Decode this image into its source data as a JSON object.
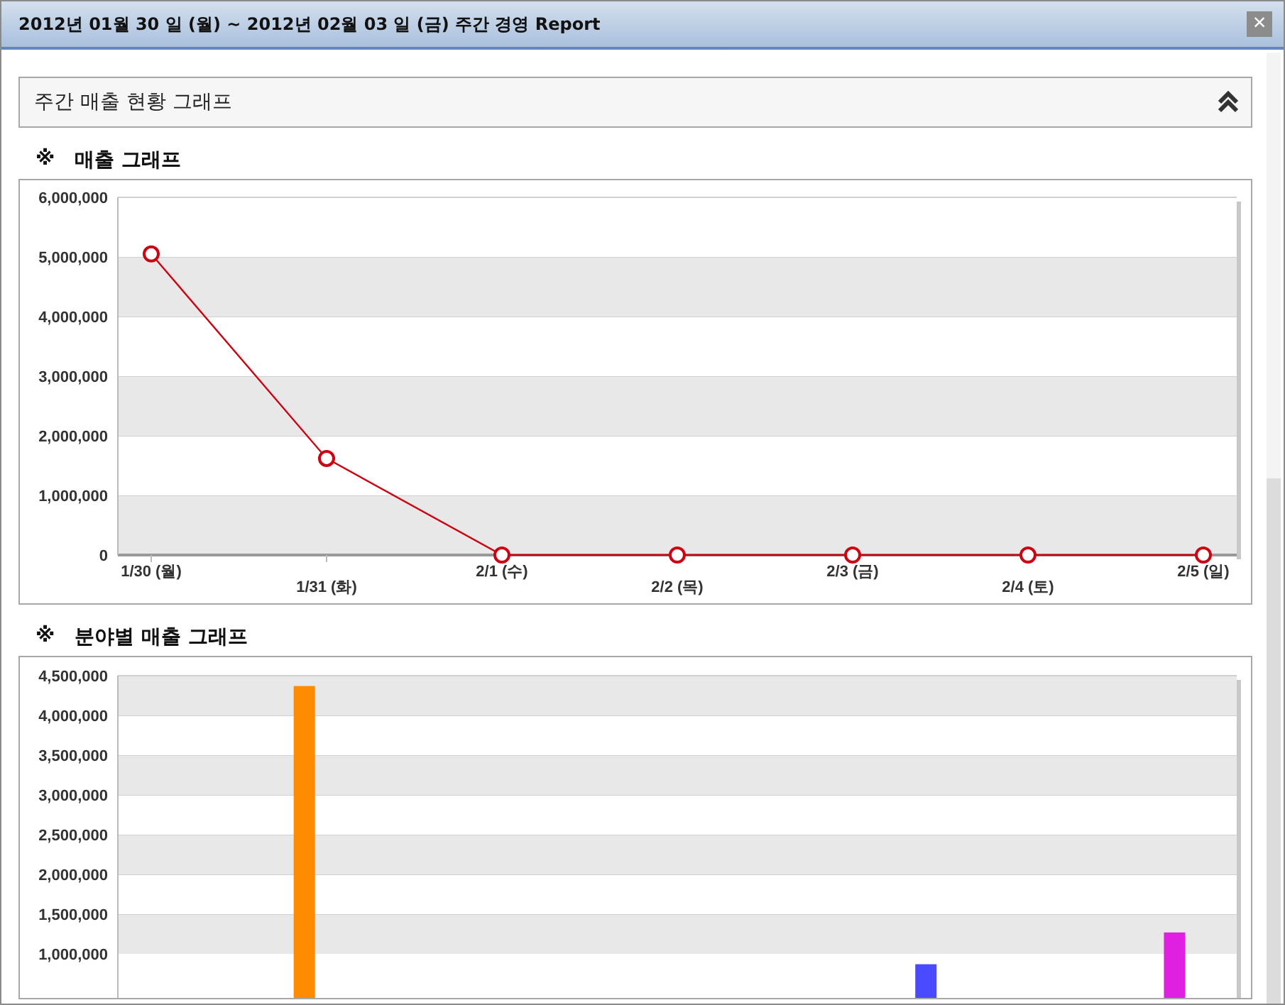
{
  "window": {
    "title": "2012년 01월 30 일 (월) ~ 2012년 02월 03 일 (금) 주간 경영 Report",
    "close": "×"
  },
  "section": {
    "title": "주간 매출 현황 그래프",
    "expanded": true
  },
  "charts": [
    {
      "mark": "※",
      "chart_data": {
        "type": "line",
        "title": "매출 그래프",
        "categories": [
          "1/30 (월)",
          "1/31 (화)",
          "2/1 (수)",
          "2/2 (목)",
          "2/3 (금)",
          "2/4 (토)",
          "2/5 (일)"
        ],
        "grid": true,
        "series": [
          {
            "color": "#cc0010",
            "marker": "o",
            "values": [
              5050000,
              1620000,
              0,
              0,
              0,
              0,
              0
            ]
          }
        ],
        "ylim": [
          0,
          6000000
        ],
        "yticks": [
          {
            "value": 0,
            "label": "0"
          },
          {
            "value": 1000000,
            "label": "1,000,000"
          },
          {
            "value": 2000000,
            "label": "2,000,000"
          },
          {
            "value": 3000000,
            "label": "3,000,000"
          },
          {
            "value": 4000000,
            "label": "4,000,000"
          },
          {
            "value": 5000000,
            "label": "5,000,000"
          },
          {
            "value": 6000000,
            "label": "6,000,000"
          }
        ]
      }
    },
    {
      "mark": "※",
      "chart_data": {
        "type": "bar",
        "title": "분야별 매출 그래프",
        "stacked": true,
        "grid": true,
        "series": [
          {
            "color": "#ff8c00",
            "values": [
              null,
              4370000,
              null,
              null,
              null,
              null,
              null,
              null,
              null
            ]
          },
          {
            "color": "#4a4aff",
            "values": [
              null,
              null,
              null,
              null,
              null,
              null,
              870000,
              null,
              null
            ]
          },
          {
            "color": "#e020e0",
            "values": [
              null,
              null,
              null,
              null,
              null,
              null,
              null,
              null,
              1270000
            ]
          }
        ],
        "ylim": [
          0,
          4500000
        ],
        "yticks": [
          {
            "value": 1000000,
            "label": "1,000,000"
          },
          {
            "value": 1500000,
            "label": "1,500,000"
          },
          {
            "value": 2000000,
            "label": "2,000,000"
          },
          {
            "value": 2500000,
            "label": "2,500,000"
          },
          {
            "value": 3000000,
            "label": "3,000,000"
          },
          {
            "value": 3500000,
            "label": "3,500,000"
          },
          {
            "value": 4000000,
            "label": "4,000,000"
          },
          {
            "value": 4500000,
            "label": "4,500,000"
          }
        ]
      }
    }
  ]
}
